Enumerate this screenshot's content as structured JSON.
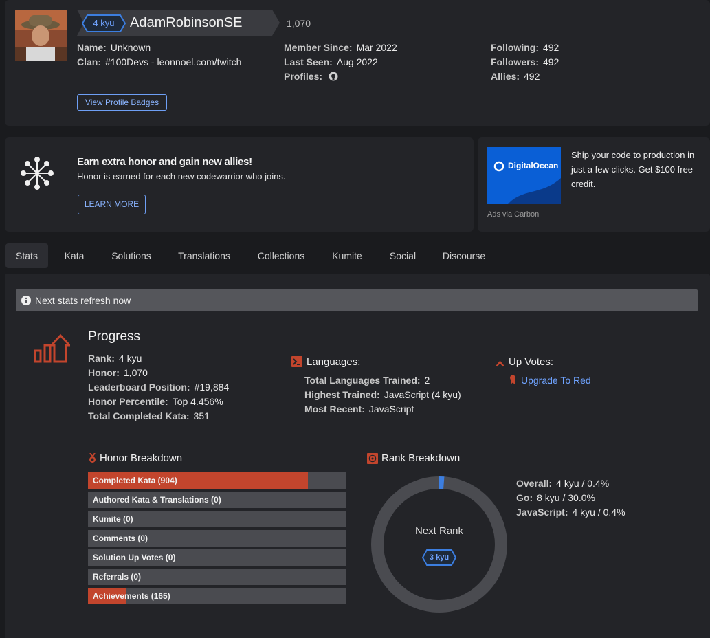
{
  "profile": {
    "rank_badge": "4 kyu",
    "username": "AdamRobinsonSE",
    "honor": "1,070",
    "name_label": "Name:",
    "name_value": "Unknown",
    "clan_label": "Clan:",
    "clan_value": "#100Devs - leonnoel.com/twitch",
    "member_since_label": "Member Since:",
    "member_since_value": "Mar 2022",
    "last_seen_label": "Last Seen:",
    "last_seen_value": "Aug 2022",
    "profiles_label": "Profiles:",
    "following_label": "Following:",
    "following_value": "492",
    "followers_label": "Followers:",
    "followers_value": "492",
    "allies_label": "Allies:",
    "allies_value": "492",
    "badges_button": "View Profile Badges"
  },
  "promo": {
    "title": "Earn extra honor and gain new allies!",
    "subtitle": "Honor is earned for each new codewarrior who joins.",
    "button": "LEARN MORE"
  },
  "ad": {
    "brand": "DigitalOcean",
    "text": "Ship your code to production in just a few clicks. Get $100 free credit.",
    "footer": "Ads via Carbon"
  },
  "tabs": [
    "Stats",
    "Kata",
    "Solutions",
    "Translations",
    "Collections",
    "Kumite",
    "Social",
    "Discourse"
  ],
  "notice": "Next stats refresh now",
  "progress": {
    "title": "Progress",
    "rank_label": "Rank:",
    "rank_value": "4 kyu",
    "honor_label": "Honor:",
    "honor_value": "1,070",
    "leaderboard_label": "Leaderboard Position:",
    "leaderboard_value": "#19,884",
    "percentile_label": "Honor Percentile:",
    "percentile_value": "Top 4.456%",
    "completed_label": "Total Completed Kata:",
    "completed_value": "351"
  },
  "languages": {
    "title": "Languages:",
    "total_label": "Total Languages Trained:",
    "total_value": "2",
    "highest_label": "Highest Trained:",
    "highest_value": "JavaScript (4 kyu)",
    "recent_label": "Most Recent:",
    "recent_value": "JavaScript"
  },
  "upvotes": {
    "title": "Up Votes:",
    "link": "Upgrade To Red"
  },
  "honor_breakdown": {
    "title": "Honor Breakdown",
    "bars": [
      {
        "label": "Completed Kata (904)",
        "fraction": 0.85
      },
      {
        "label": "Authored Kata & Translations (0)",
        "fraction": 0
      },
      {
        "label": "Kumite (0)",
        "fraction": 0
      },
      {
        "label": "Comments (0)",
        "fraction": 0
      },
      {
        "label": "Solution Up Votes (0)",
        "fraction": 0
      },
      {
        "label": "Referrals (0)",
        "fraction": 0
      },
      {
        "label": "Achievements (165)",
        "fraction": 0.15
      }
    ]
  },
  "rank_breakdown": {
    "title": "Rank Breakdown",
    "center_label": "Next Rank",
    "next_rank": "3 kyu",
    "progress_fraction": 0.004,
    "overall_label": "Overall:",
    "overall_value": "4 kyu / 0.4%",
    "go_label": "Go:",
    "go_value": "8 kyu / 30.0%",
    "js_label": "JavaScript:",
    "js_value": "4 kyu / 0.4%"
  },
  "colors": {
    "accent_red": "#c2452d",
    "link_blue": "#8ab4ff",
    "rank_blue": "#3c7ee0"
  }
}
